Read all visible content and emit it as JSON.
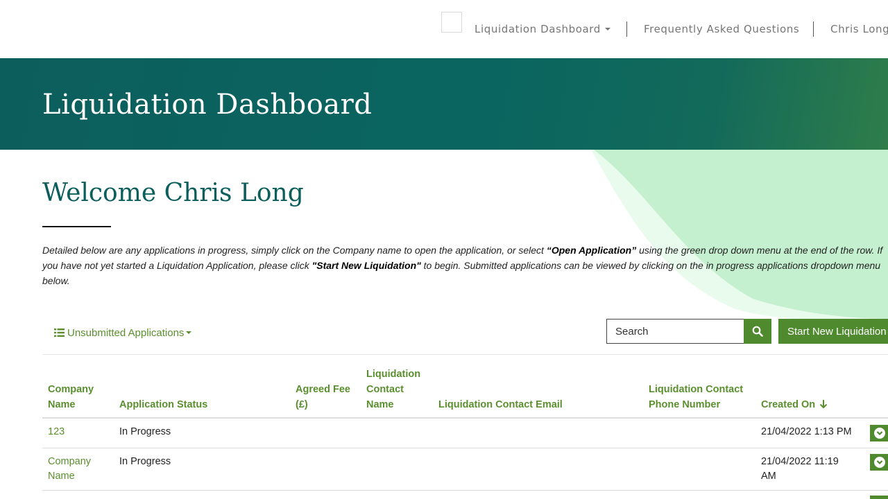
{
  "nav": {
    "dashboard_label": "Liquidation Dashboard",
    "faq_label": "Frequently Asked Questions",
    "user_label": "Chris Long"
  },
  "banner": {
    "title": "Liquidation Dashboard"
  },
  "welcome": {
    "heading": "Welcome Chris Long"
  },
  "intro": {
    "part1": "Detailed below are any applications in progress, simply click on the Company name to open the application, or select ",
    "open_app": "“Open Application”",
    "part2": " using the green drop down menu at the end of the row. If you have not yet started a Liquidation Application, please click ",
    "start_new": "\"Start New Liquidation\"",
    "part3": " to begin. Submitted applications can be viewed by clicking on the in progress applications dropdown menu below."
  },
  "toolbar": {
    "filter_label": "Unsubmitted Applications",
    "search_placeholder": "Search",
    "start_button": "Start New Liquidation"
  },
  "table": {
    "headers": {
      "company_1": "Company",
      "company_2": "Name",
      "status": "Application Status",
      "fee_1": "Agreed Fee",
      "fee_2": "(£)",
      "contact_1": "Liquidation",
      "contact_2": "Contact",
      "contact_3": "Name",
      "email": "Liquidation Contact Email",
      "phone_1": "Liquidation Contact",
      "phone_2": "Phone Number",
      "created": "Created On"
    },
    "rows": [
      {
        "company_1": "123",
        "company_2": "",
        "status": "In Progress",
        "created_1": "21/04/2022 1:13 PM",
        "created_2": ""
      },
      {
        "company_1": "Company",
        "company_2": "Name",
        "status": "In Progress",
        "created_1": "21/04/2022 11:19",
        "created_2": "AM"
      }
    ]
  },
  "colors": {
    "brand_teal": "#0c5e5c",
    "brand_green": "#4f8a2e",
    "link_green": "#5a8f2e",
    "deco_mint": "#c4f0cf"
  }
}
